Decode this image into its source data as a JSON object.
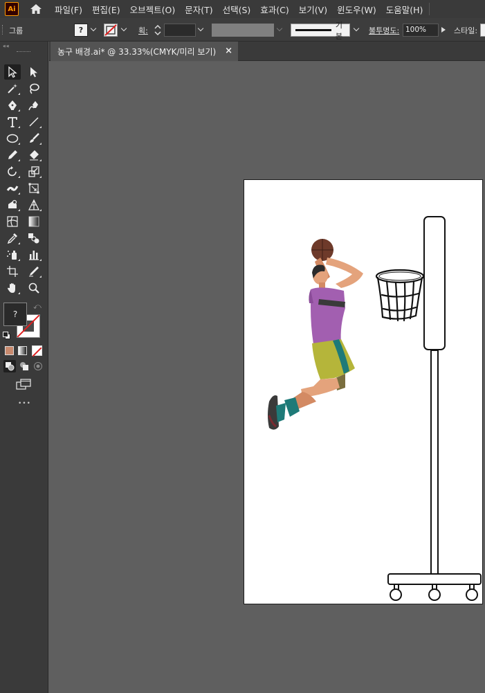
{
  "app": {
    "logo_text": "Ai",
    "accent": "#ff9a00"
  },
  "menu": [
    "파일(F)",
    "편집(E)",
    "오브젝트(O)",
    "문자(T)",
    "선택(S)",
    "효과(C)",
    "보기(V)",
    "윈도우(W)",
    "도움말(H)"
  ],
  "control_bar": {
    "selection_type": "그룹",
    "fill_value": "?",
    "stroke_label": "획:",
    "stroke_profile": "기본",
    "opacity_label": "불투명도:",
    "opacity_value": "100%",
    "style_label": "스타일:"
  },
  "document": {
    "tab_title": "농구 배경.ai* @ 33.33%(CMYK/미리 보기)",
    "close_glyph": "×"
  },
  "toolbar": {
    "collapse_glyph": "««",
    "fill_swatch_text": "?",
    "more_glyph": "•••"
  },
  "colors": {
    "ui_dark": "#3a3a3a",
    "canvas_bg": "#5f5f5f",
    "artboard": "#ffffff",
    "jersey_purple": "#a25fb0",
    "shorts_olive": "#b5b53a",
    "shorts_teal": "#1e7a78",
    "skin": "#e4a37c"
  }
}
